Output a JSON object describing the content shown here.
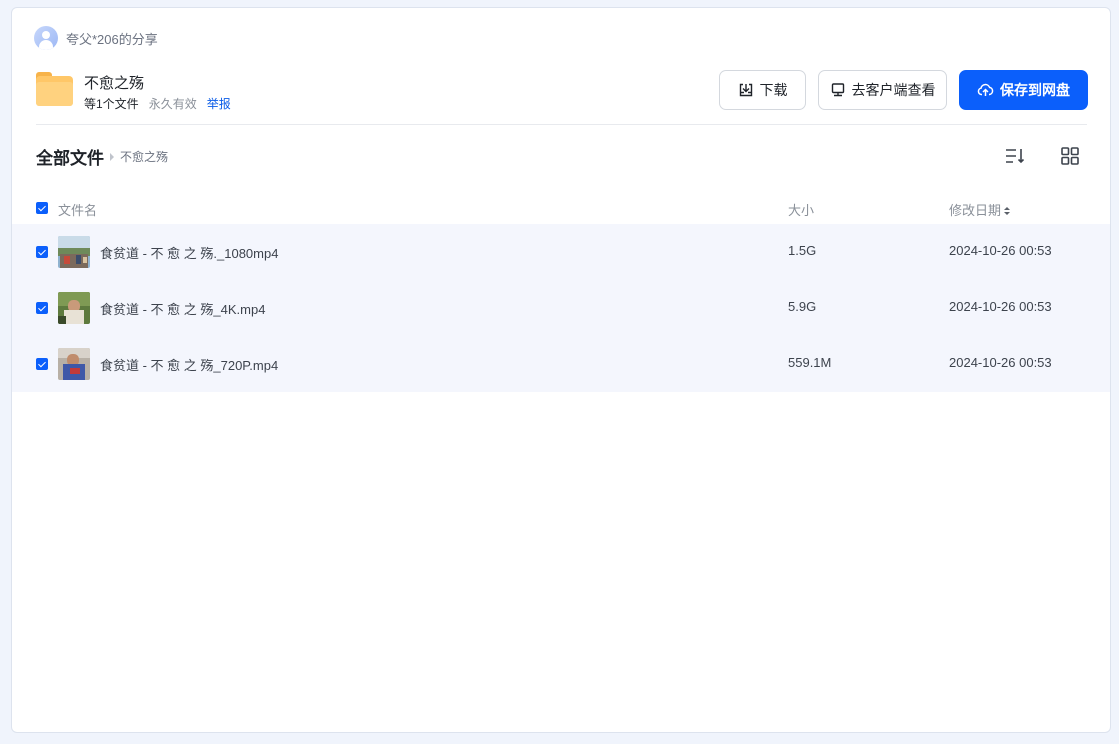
{
  "sharer": {
    "text": "夸父*206的分享"
  },
  "share": {
    "title": "不愈之殇",
    "file_count": "等1个文件",
    "validity": "永久有效",
    "report": "举报"
  },
  "actions": {
    "download": "下载",
    "open_client": "去客户端查看",
    "save": "保存到网盘"
  },
  "breadcrumb": {
    "root": "全部文件",
    "current": "不愈之殇"
  },
  "table": {
    "columns": {
      "name": "文件名",
      "size": "大小",
      "date": "修改日期"
    },
    "rows": [
      {
        "name": "食贫道 - 不 愈 之 殇._1080mp4",
        "size": "1.5G",
        "date": "2024-10-26 00:53"
      },
      {
        "name": "食贫道 - 不 愈 之 殇_4K.mp4",
        "size": "5.9G",
        "date": "2024-10-26 00:53"
      },
      {
        "name": "食贫道 - 不 愈 之 殇_720P.mp4",
        "size": "559.1M",
        "date": "2024-10-26 00:53"
      }
    ]
  },
  "colors": {
    "accent": "#0b5ffb",
    "row_selected": "#f4f6fd",
    "folder": "#ffc768"
  },
  "icons": [
    "user-avatar-icon",
    "folder-icon",
    "download-icon",
    "monitor-icon",
    "cloud-upload-icon",
    "sort-list-icon",
    "grid-view-icon",
    "checkbox-checked-icon",
    "sort-arrows-icon",
    "video-thumbnail"
  ]
}
